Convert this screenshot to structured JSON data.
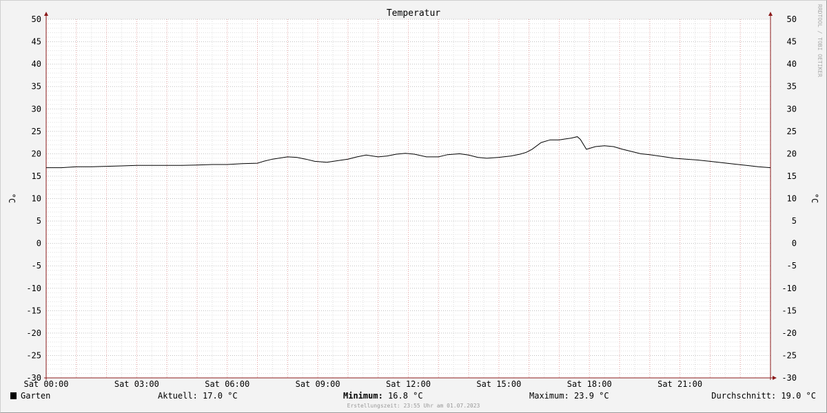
{
  "chart_data": {
    "type": "line",
    "title": "Temperatur",
    "ylabel_left": "°C",
    "ylabel_right": "°C",
    "ylim": [
      -30,
      50
    ],
    "y_ticks": [
      50,
      45,
      40,
      35,
      30,
      25,
      20,
      15,
      10,
      5,
      0,
      -5,
      -10,
      -15,
      -20,
      -25,
      -30
    ],
    "xlim_hours": [
      0,
      24
    ],
    "x_ticks": [
      {
        "hour": 0,
        "label": "Sat 00:00"
      },
      {
        "hour": 3,
        "label": "Sat 03:00"
      },
      {
        "hour": 6,
        "label": "Sat 06:00"
      },
      {
        "hour": 9,
        "label": "Sat 09:00"
      },
      {
        "hour": 12,
        "label": "Sat 12:00"
      },
      {
        "hour": 15,
        "label": "Sat 15:00"
      },
      {
        "hour": 18,
        "label": "Sat 18:00"
      },
      {
        "hour": 21,
        "label": "Sat 21:00"
      }
    ],
    "grid": true,
    "colors": {
      "background": "#f3f3f3",
      "canvas": "#ffffff",
      "major_grid": "#e8a0a0",
      "minor_grid": "#dddddd",
      "axis": "#8b1a1a",
      "line": "#000000"
    },
    "series": [
      {
        "name": "Garten",
        "color": "#000000",
        "x": [
          0,
          0.5,
          1.0,
          1.5,
          2.0,
          2.5,
          3.0,
          3.5,
          4.0,
          4.5,
          5.0,
          5.5,
          6.0,
          6.5,
          7.0,
          7.2,
          7.5,
          8.0,
          8.3,
          8.6,
          8.9,
          9.3,
          9.7,
          10.0,
          10.3,
          10.6,
          11.0,
          11.3,
          11.6,
          11.9,
          12.2,
          12.6,
          13.0,
          13.3,
          13.7,
          14.0,
          14.3,
          14.6,
          15.0,
          15.4,
          15.7,
          15.9,
          16.1,
          16.4,
          16.7,
          17.0,
          17.2,
          17.4,
          17.6,
          17.7,
          17.9,
          18.2,
          18.5,
          18.8,
          19.1,
          19.4,
          19.7,
          20.0,
          20.4,
          20.8,
          21.2,
          21.6,
          22.0,
          22.4,
          22.8,
          23.2,
          23.6,
          24.0
        ],
        "values": [
          16.9,
          16.9,
          17.1,
          17.1,
          17.2,
          17.3,
          17.4,
          17.4,
          17.4,
          17.4,
          17.5,
          17.6,
          17.6,
          17.8,
          17.9,
          18.3,
          18.8,
          19.3,
          19.2,
          18.8,
          18.3,
          18.1,
          18.5,
          18.8,
          19.3,
          19.7,
          19.3,
          19.5,
          19.9,
          20.1,
          19.9,
          19.3,
          19.3,
          19.8,
          20.0,
          19.7,
          19.2,
          19.0,
          19.2,
          19.5,
          19.9,
          20.3,
          21.0,
          22.5,
          23.1,
          23.1,
          23.3,
          23.5,
          23.8,
          23.2,
          21.0,
          21.6,
          21.8,
          21.6,
          21.0,
          20.5,
          20.0,
          19.8,
          19.4,
          19.0,
          18.8,
          18.6,
          18.3,
          18.0,
          17.7,
          17.4,
          17.1,
          16.9
        ]
      }
    ]
  },
  "legend": {
    "series_name": "Garten",
    "aktuell": "Aktuell: 17.0 °C",
    "minimum_label": "Minimum:",
    "minimum_value": " 16.8 °C",
    "maximum": "Maximum: 23.9 °C",
    "durchschnitt": "Durchschnitt: 19.0 °C"
  },
  "footer": "Erstellungszeit: 23:55 Uhr am 01.07.2023",
  "watermark": "RRDTOOL / TOBI OETIKER"
}
